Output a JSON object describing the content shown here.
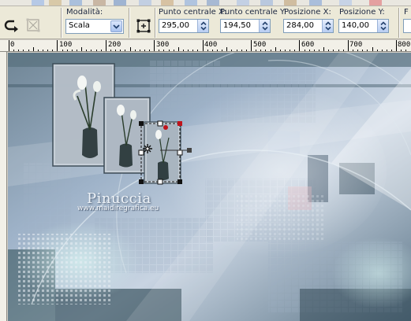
{
  "options": {
    "mode_label": "Modalità:",
    "mode_value": "Scala",
    "center_x_label": "Punto centrale X:",
    "center_x_value": "295,00",
    "center_y_label": "Punto centrale Y:",
    "center_y_value": "194,50",
    "pos_x_label": "Posizione X:",
    "pos_x_value": "284,00",
    "pos_y_label": "Posizione Y:",
    "pos_y_value": "140,00",
    "cut_label": "F"
  },
  "ruler": {
    "ticks": [
      "0",
      "100",
      "200",
      "300",
      "400",
      "500",
      "600",
      "700",
      "800"
    ]
  },
  "canvas": {
    "watermark_title": "Pinuccia",
    "watermark_url": "www.maidiregrafica.eu"
  },
  "colors": {
    "toolbar_bg": "#ece9d8",
    "field_border": "#7f9db9",
    "selection_handle_red": "#c0141c",
    "canvas_base": "#8ea2b8"
  }
}
